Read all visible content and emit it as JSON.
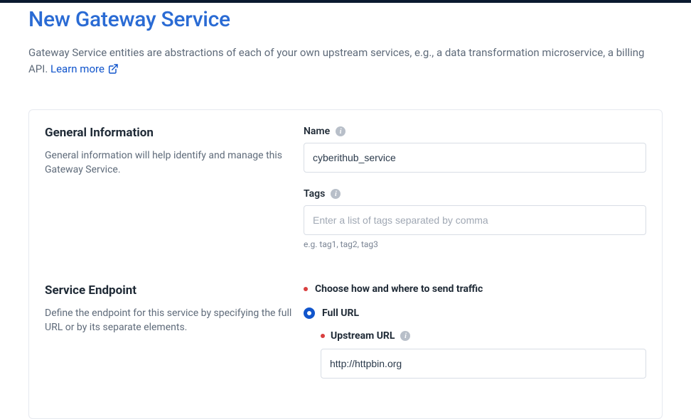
{
  "title": "New Gateway Service",
  "subtitle_a": "Gateway Service entities are abstractions of each of your own upstream services, e.g., a data transformation microservice, a billing API. ",
  "learn_more": "Learn more",
  "sections": {
    "general": {
      "heading": "General Information",
      "desc": "General information will help identify and manage this Gateway Service."
    },
    "endpoint": {
      "heading": "Service Endpoint",
      "desc": "Define the endpoint for this service by specifying the full URL or by its separate elements."
    }
  },
  "fields": {
    "name": {
      "label": "Name",
      "value": "cyberithub_service"
    },
    "tags": {
      "label": "Tags",
      "placeholder": "Enter a list of tags separated by comma",
      "helper": "e.g. tag1, tag2, tag3",
      "value": ""
    },
    "traffic_prompt": "Choose how and where to send traffic",
    "full_url_label": "Full URL",
    "upstream": {
      "label": "Upstream URL",
      "value": "http://httpbin.org"
    }
  },
  "icons": {
    "info": "i"
  }
}
